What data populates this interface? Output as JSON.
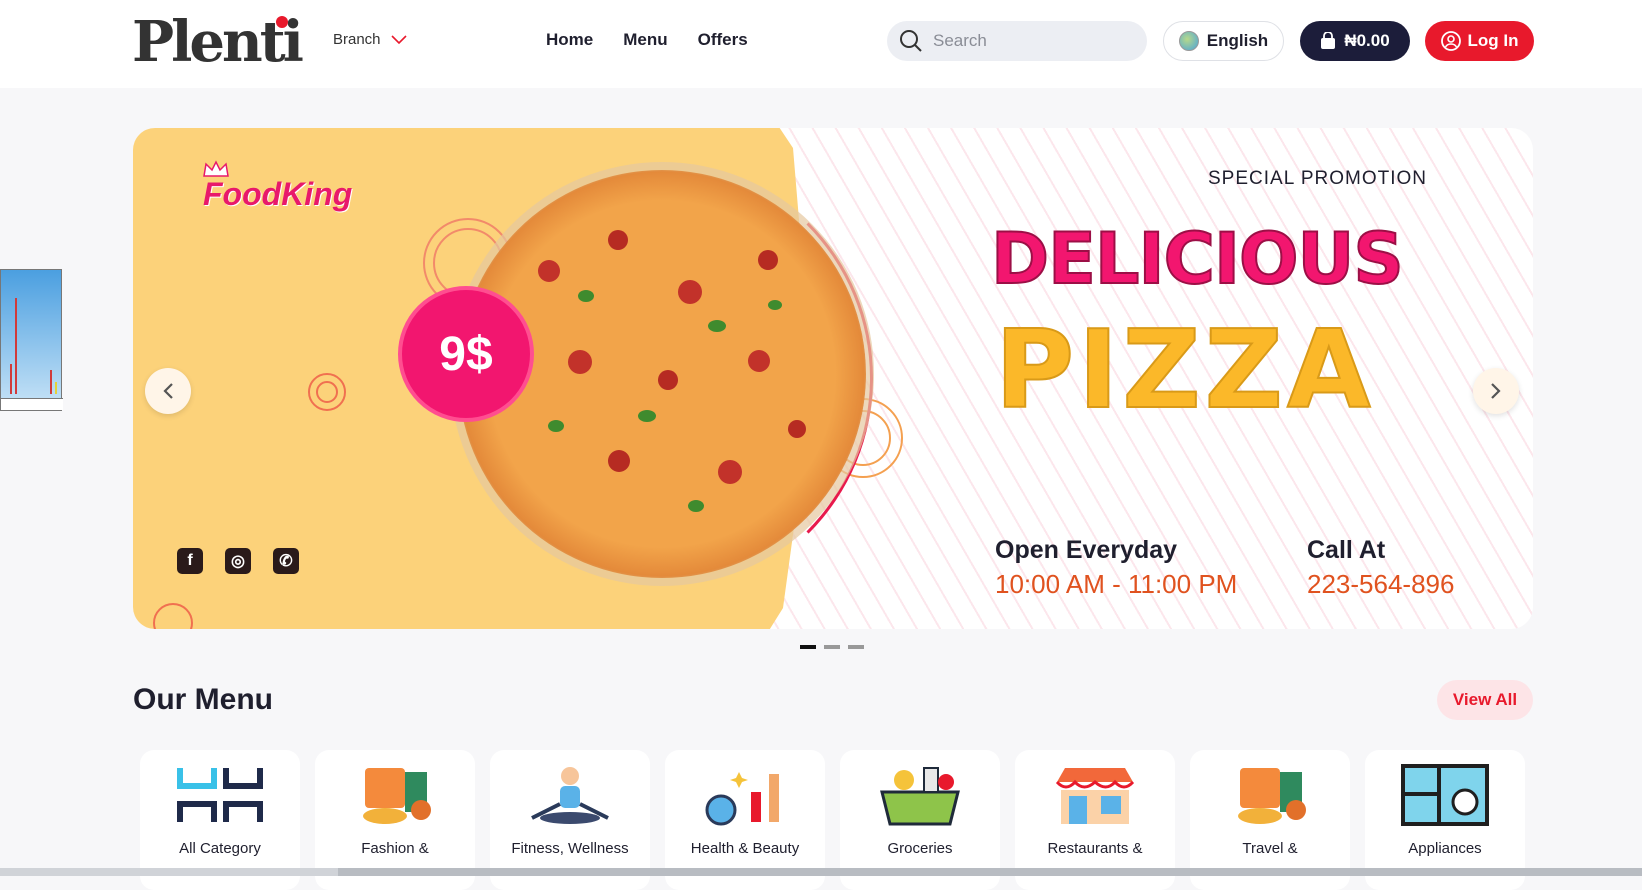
{
  "header": {
    "logo": "Plenti",
    "branch_label": "Branch",
    "nav": [
      "Home",
      "Menu",
      "Offers"
    ],
    "search_placeholder": "Search",
    "language": "English",
    "cart_total": "₦0.00",
    "login_label": "Log In"
  },
  "banner": {
    "brand": "FoodKing",
    "price": "9$",
    "special": "SPECIAL PROMOTION",
    "headline_1": "DELICIOUS",
    "headline_2": "PIZZA",
    "open_label": "Open Everyday",
    "open_hours": "10:00 AM - 11:00 PM",
    "call_label": "Call At",
    "phone": "223-564-896",
    "social_icons": [
      "facebook-icon",
      "instagram-icon",
      "whatsapp-icon"
    ],
    "slides": 3,
    "active_slide": 1
  },
  "menu_section": {
    "title": "Our Menu",
    "view_all": "View All",
    "categories": [
      {
        "label": "All Category",
        "icon": "grid-icon"
      },
      {
        "label": "Fashion &",
        "icon": "fashion-icon"
      },
      {
        "label": "Fitness, Wellness",
        "icon": "fitness-icon"
      },
      {
        "label": "Health & Beauty",
        "icon": "beauty-icon"
      },
      {
        "label": "Groceries",
        "icon": "groceries-icon"
      },
      {
        "label": "Restaurants &",
        "icon": "restaurant-icon"
      },
      {
        "label": "Travel &",
        "icon": "travel-icon"
      },
      {
        "label": "Appliances",
        "icon": "appliances-icon"
      }
    ]
  },
  "colors": {
    "brand_red": "#e8192c",
    "navy": "#1c1d3a",
    "banner_yellow": "#fcd27a",
    "banner_pink": "#f2166f",
    "banner_orange": "#fbb829"
  }
}
